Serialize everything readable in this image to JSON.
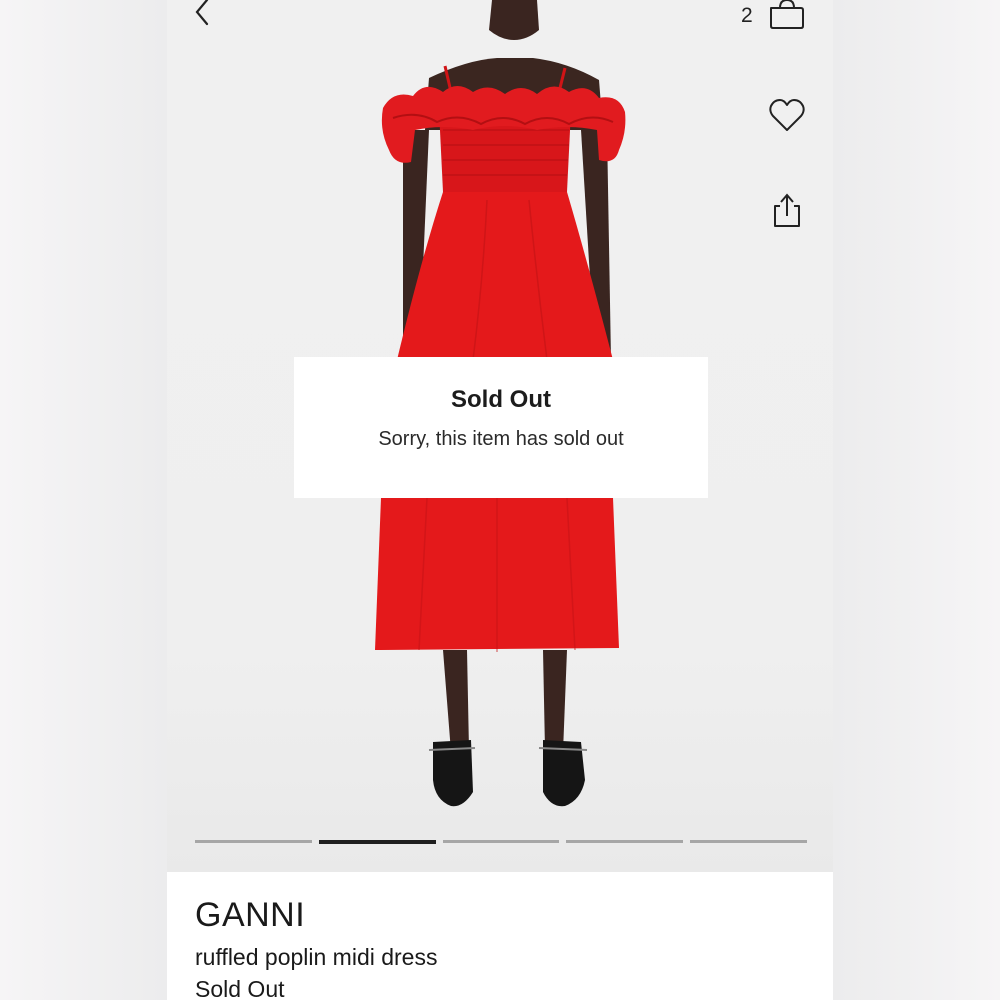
{
  "header": {
    "back_icon": "chevron-left-icon",
    "cart_count": "2",
    "cart_icon": "shopping-bag-icon",
    "wishlist_icon": "heart-icon",
    "share_icon": "share-icon"
  },
  "modal": {
    "title": "Sold Out",
    "message": "Sorry, this item has sold out"
  },
  "gallery": {
    "image_count": 5,
    "active_index": 1
  },
  "product": {
    "brand": "GANNI",
    "name": "ruffled poplin midi dress",
    "status": "Sold Out"
  },
  "colors": {
    "dress": "#e4191b",
    "accent": "#1f1f1f"
  }
}
